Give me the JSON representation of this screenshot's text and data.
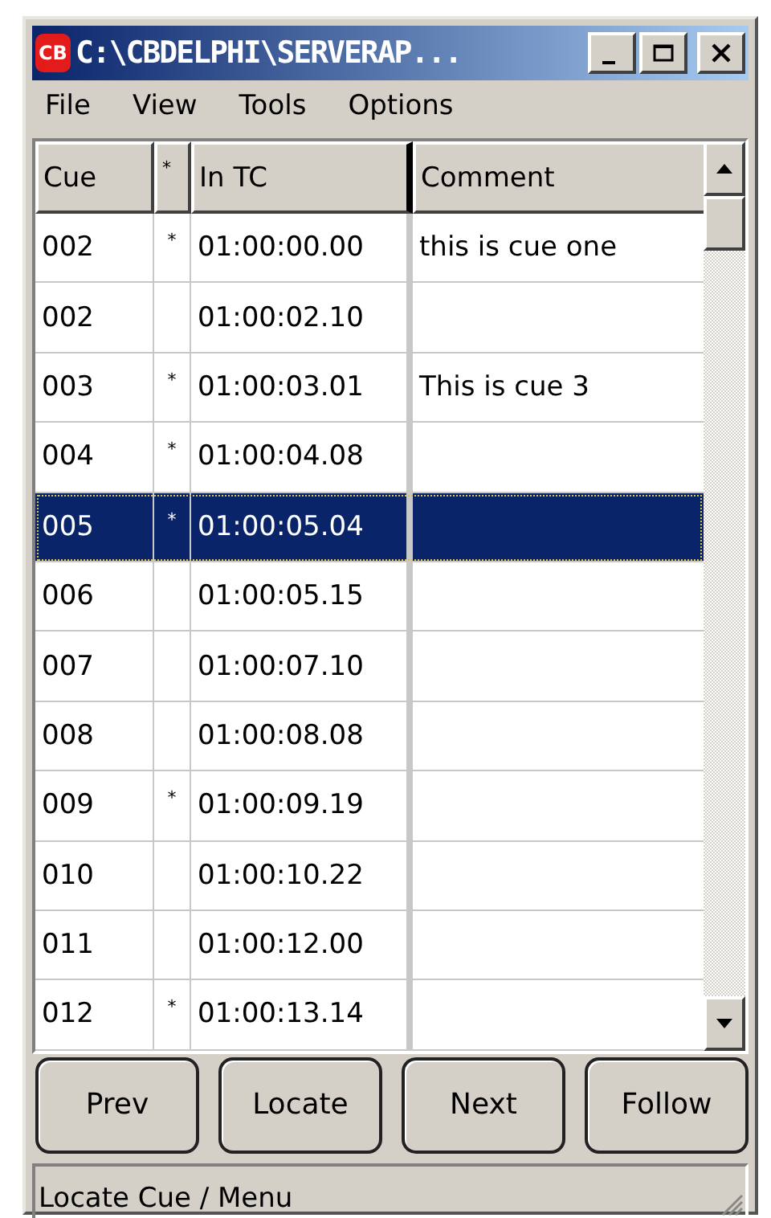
{
  "window": {
    "title": "C:\\CBDELPHI\\SERVERAP...",
    "app_icon_text": "CB"
  },
  "menu": [
    "File",
    "View",
    "Tools",
    "Options"
  ],
  "table": {
    "columns": [
      "Cue",
      "*",
      "In TC",
      "Comment"
    ],
    "rows": [
      {
        "cue": "002",
        "flag": "*",
        "in_tc": "01:00:00.00",
        "comment": "this is cue one",
        "selected": false
      },
      {
        "cue": "002",
        "in_tc": "01:00:02.10",
        "selected": false
      },
      {
        "cue": "003",
        "flag": "*",
        "in_tc": "01:00:03.01",
        "comment": "This is cue 3",
        "selected": false
      },
      {
        "cue": "004",
        "flag": "*",
        "in_tc": "01:00:04.08",
        "selected": false
      },
      {
        "cue": "005",
        "flag": "*",
        "in_tc": "01:00:05.04",
        "selected": true
      },
      {
        "cue": "006",
        "in_tc": "01:00:05.15",
        "selected": false
      },
      {
        "cue": "007",
        "in_tc": "01:00:07.10",
        "selected": false
      },
      {
        "cue": "008",
        "in_tc": "01:00:08.08",
        "selected": false
      },
      {
        "cue": "009",
        "flag": "*",
        "in_tc": "01:00:09.19",
        "selected": false
      },
      {
        "cue": "010",
        "in_tc": "01:00:10.22",
        "selected": false
      },
      {
        "cue": "011",
        "in_tc": "01:00:12.00",
        "selected": false
      },
      {
        "cue": "012",
        "flag": "*",
        "in_tc": "01:00:13.14",
        "selected": false
      }
    ]
  },
  "buttons": [
    "Prev",
    "Locate",
    "Next",
    "Follow"
  ],
  "status_bar": "Locate Cue / Menu"
}
